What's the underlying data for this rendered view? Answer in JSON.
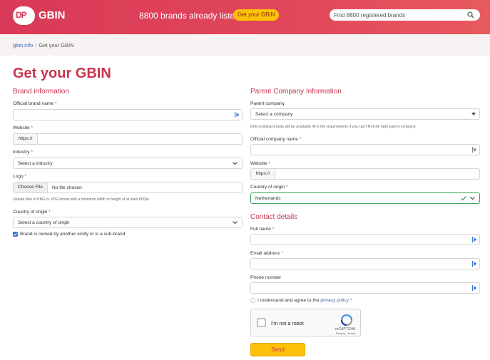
{
  "header": {
    "logo_mark": "DP",
    "logo_text": "GBIN",
    "brands_count_text": "8800 brands already listed",
    "cta_label": "Get your GBIN",
    "search_placeholder": "Find 8800 registered brands"
  },
  "breadcrumb": {
    "home": "gbin.info",
    "separator": "/",
    "current": "Get your GBIN"
  },
  "page_title": "Get your GBIN",
  "brand": {
    "title": "Brand information",
    "official_name_label": "Official brand name",
    "website_label": "Website",
    "website_prefix": "https://",
    "industry_label": "Industry",
    "industry_value": "Select a industry",
    "logo_label": "Logo",
    "file_button": "Choose File",
    "file_name": "No file chosen",
    "logo_help": "Upload files in PNG or JPG format with a minimum width or height of at least 800px",
    "country_label": "Country of origin",
    "country_value": "Select a country of origin",
    "sub_brand_label": "Brand is owned by another entity or is a sub-brand",
    "required_mark": "*"
  },
  "parent": {
    "title": "Parent Company Information",
    "company_label": "Parent company",
    "company_value": "Select a company",
    "company_help": "Only existing brands will be available fill in the requirements if you can't find the right parent company",
    "official_name_label": "Official company name",
    "website_label": "Website",
    "website_prefix": "https://",
    "country_label": "Country of origin",
    "country_value": "Netherlands"
  },
  "contact": {
    "title": "Contact details",
    "full_name_label": "Full name",
    "email_label": "Email address",
    "phone_label": "Phone number",
    "privacy_text": "I understand and agree to the",
    "privacy_link": "privacy policy"
  },
  "captcha": {
    "label": "I'm not a robot",
    "brand": "reCAPTCHA",
    "terms": "Privacy - Terms"
  },
  "send_label": "Send",
  "colors": {
    "brand": "#d93a57",
    "accent": "#ffc107",
    "link": "#3b66b3",
    "valid": "#3aa35b"
  }
}
